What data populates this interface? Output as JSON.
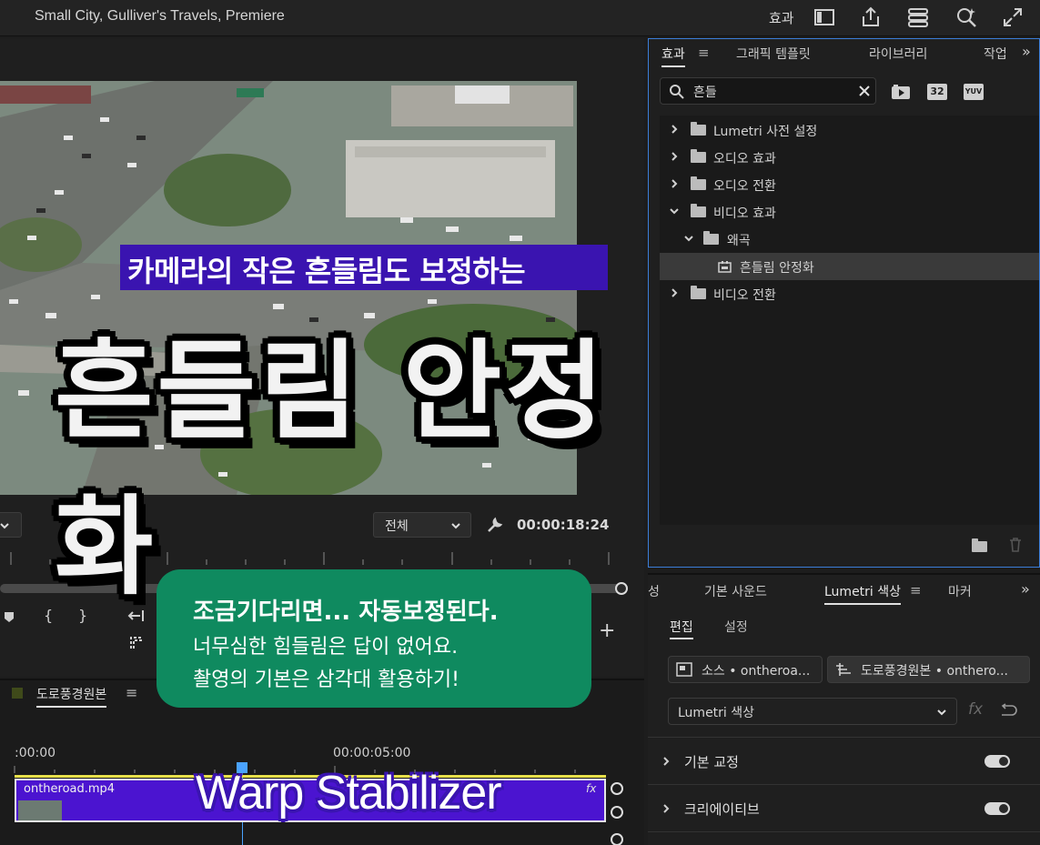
{
  "title_bar": {
    "title": "Small City, Gulliver's Travels, Premiere",
    "workspace": "효과",
    "icons": [
      "panel-layout-icon",
      "export-icon",
      "quick-export-icon",
      "search-zoom-icon",
      "fullscreen-icon"
    ]
  },
  "program_monitor": {
    "fit_select": "전체",
    "timecode": "00:00:18:24"
  },
  "overlays": {
    "sub_caption": "카메라의 작은 흔들림도 보정하는",
    "big_title": "흔들림 안정화",
    "note_line1": "조금기다리면... 자동보정된다.",
    "note_line2": "너무심한 힘들림은 답이 없어요.",
    "note_line3": "촬영의 기본은 삼각대 활용하기!",
    "warp_label": "Warp Stabilizer"
  },
  "timeline": {
    "sequence_name": "도로풍경원본",
    "time_start": ":00:00",
    "time_mark": "00:00:05:00",
    "clip_name": "ontheroad.mp4",
    "clip_fx": "fx",
    "clip_color": "#4b14d0"
  },
  "effects_panel": {
    "tabs": [
      "효과",
      "그래픽 템플릿",
      "라이브러리",
      "작업"
    ],
    "search_value": "흔들",
    "filter_icons": [
      "accelerated-effects-icon",
      "32bit-icon",
      "yuv-icon"
    ],
    "filter_labels": [
      "32",
      "YUV"
    ],
    "tree": [
      {
        "label": "Lumetri 사전 설정",
        "expanded": false
      },
      {
        "label": "오디오 효과",
        "expanded": false
      },
      {
        "label": "오디오 전환",
        "expanded": false
      },
      {
        "label": "비디오 효과",
        "expanded": true
      },
      {
        "label": "왜곡",
        "expanded": true
      },
      {
        "label": "흔들림 안정화",
        "expanded": false
      },
      {
        "label": "비디오 전환",
        "expanded": false
      }
    ]
  },
  "lumetri_panel": {
    "tabs": [
      "성",
      "기본 사운드",
      "Lumetri 색상",
      "마커"
    ],
    "subtabs": [
      "편집",
      "설정"
    ],
    "source_chip": "소스 • ontheroa...",
    "sequence_chip": "도로풍경원본 • onthero...",
    "effect_select": "Lumetri 색상",
    "sections": [
      "기본 교정",
      "크리에이티브"
    ]
  },
  "colors": {
    "accent_blue": "#3b7dd8",
    "caption_purple": "#3a14b0",
    "note_green": "#0f8a5f",
    "playhead": "#4aa3ff"
  }
}
